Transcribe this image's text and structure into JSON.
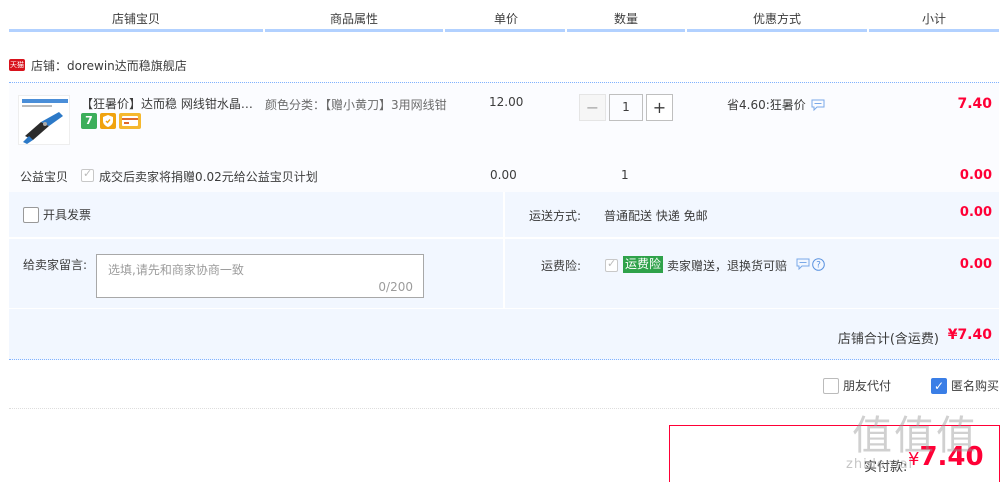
{
  "header": {
    "columns": [
      "店铺宝贝",
      "商品属性",
      "单价",
      "数量",
      "优惠方式",
      "小计"
    ]
  },
  "shop": {
    "badge": "天猫",
    "label": "店铺：dorewin达而稳旗舰店"
  },
  "item": {
    "title": "【狂暑价】达而稳 网线钳水晶头压线钳",
    "attr": "颜色分类：【赠小黄刀】3用网线钳",
    "price": "12.00",
    "qty_minus": "−",
    "qty": "1",
    "qty_plus": "+",
    "promo": "省4.60:狂暑价",
    "subtotal": "7.40",
    "icon_7": "7"
  },
  "charity": {
    "label": "公益宝贝",
    "text": "成交后卖家将捐赠0.02元给公益宝贝计划",
    "price": "0.00",
    "qty": "1",
    "subtotal": "0.00"
  },
  "options": {
    "invoice": "开具发票",
    "message_label": "给卖家留言:",
    "message_placeholder": "选填,请先和商家协商一致",
    "message_count": "0/200",
    "shipping_label": "运送方式:",
    "shipping_value": "普通配送 快递 免邮",
    "shipping_price": "0.00",
    "insurance_label": "运费险:",
    "insurance_badge": "运费险",
    "insurance_text": "卖家赠送，退换货可赔",
    "insurance_price": "0.00"
  },
  "shop_total": {
    "label": "店铺合计(含运费)",
    "value": "¥7.40"
  },
  "bottom": {
    "friend_pay": "朋友代付",
    "anonymous": "匿名购买"
  },
  "pay": {
    "label": "实付款:",
    "currency": "¥",
    "amount": "7.40"
  },
  "watermark": {
    "logo": "值值值",
    "site": "zhidemai"
  },
  "colors": {
    "accent": "#ff0036",
    "header_line": "#b2d1ff",
    "panel": "#f2f7ff",
    "checkbox_blue": "#3a7ee6",
    "insurance_green": "#2fa24a"
  }
}
